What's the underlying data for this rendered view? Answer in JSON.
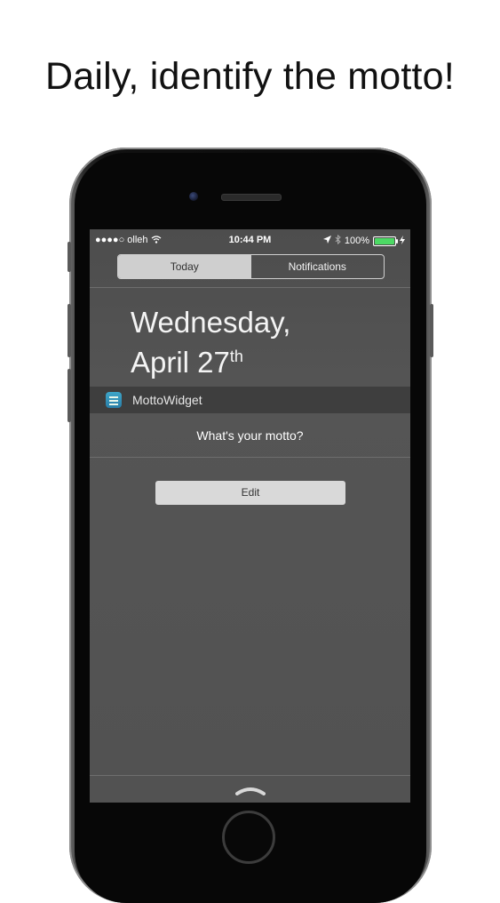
{
  "headline": "Daily, identify the motto!",
  "status_bar": {
    "carrier": "●●●●○ olleh",
    "time": "10:44 PM",
    "battery_percent_label": "100%",
    "battery_level": 1.0,
    "battery_color": "#4cd964"
  },
  "segmented_control": {
    "tabs": [
      {
        "label": "Today",
        "active": true
      },
      {
        "label": "Notifications",
        "active": false
      }
    ]
  },
  "date": {
    "weekday": "Wednesday,",
    "month_day": "April 27",
    "suffix": "th"
  },
  "widget": {
    "icon": "motto-app-icon",
    "title": "MottoWidget",
    "prompt": "What's your motto?",
    "edit_label": "Edit"
  },
  "icons": {
    "wifi": "wifi-icon",
    "location": "location-arrow-icon",
    "bluetooth": "bluetooth-icon",
    "charging": "charging-bolt-icon",
    "grabber": "chevron-up-icon"
  }
}
